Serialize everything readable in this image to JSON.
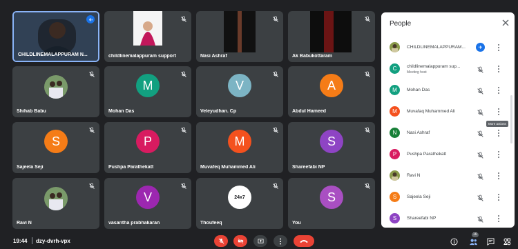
{
  "colors": {
    "accent": "#1a73e8",
    "danger": "#ea4335",
    "tile_bg": "#3c4043",
    "page_bg": "#202124"
  },
  "tiles": [
    {
      "name": "CHILDLINEMALAPPURAM N...",
      "type": "video",
      "speaking": true
    },
    {
      "name": "childlinemalappuram support",
      "type": "video",
      "muted": true
    },
    {
      "name": "Nasi Ashraf",
      "type": "video",
      "muted": true
    },
    {
      "name": "Ak Babukottaram",
      "type": "video",
      "muted": true
    },
    {
      "name": "Shihab Babu",
      "type": "photo",
      "muted": true
    },
    {
      "name": "Mohan Das",
      "initial": "M",
      "color": "#12a080",
      "muted": true
    },
    {
      "name": "Veleyudhan. Cp",
      "initial": "V",
      "color": "#7cb4c4",
      "muted": true
    },
    {
      "name": "Abdul Hameed",
      "initial": "A",
      "color": "#f57c17",
      "muted": true
    },
    {
      "name": "Sajeela Seji",
      "initial": "S",
      "color": "#f57c17",
      "muted": true
    },
    {
      "name": "Pushpa Parathekatt",
      "initial": "P",
      "color": "#d81b60",
      "muted": true
    },
    {
      "name": "Muvafeq Muhammed Ali",
      "initial": "M",
      "color": "#f4511e",
      "muted": true
    },
    {
      "name": "Shareefabi NP",
      "initial": "S",
      "color": "#8e44c4",
      "muted": true
    },
    {
      "name": "Ravi N",
      "type": "photo",
      "muted": true
    },
    {
      "name": "vasantha prabhakaran",
      "initial": "V",
      "color": "#9c27b0",
      "muted": true
    },
    {
      "name": "Thoufeeq",
      "type": "logo",
      "logo_text": "24x7",
      "muted": true
    },
    {
      "name": "You",
      "initial": "S",
      "color": "#a94fc2",
      "muted": true
    }
  ],
  "people_panel": {
    "title": "People",
    "tooltip": "More actions",
    "participants": [
      {
        "name": "CHILDLINEMALAPPURAM...",
        "sub": "",
        "avatar": "photo",
        "speaking": true
      },
      {
        "name": "childlinemalappuram sup...",
        "sub": "Meeting host",
        "initial": "C",
        "color": "#12a080"
      },
      {
        "name": "Mohan Das",
        "sub": "",
        "initial": "M",
        "color": "#12a080"
      },
      {
        "name": "Muvafaq Muhammed Ali",
        "sub": "",
        "initial": "M",
        "color": "#f4511e"
      },
      {
        "name": "Nasi Ashraf",
        "sub": "",
        "initial": "N",
        "color": "#188038"
      },
      {
        "name": "Pushpa Parathekatt",
        "sub": "",
        "initial": "P",
        "color": "#d81b60"
      },
      {
        "name": "Ravi N",
        "sub": "",
        "avatar": "photo"
      },
      {
        "name": "Sajeela Seji",
        "sub": "",
        "initial": "S",
        "color": "#f57c17"
      },
      {
        "name": "Shareefabi NP",
        "sub": "",
        "initial": "S",
        "color": "#8e44c4"
      }
    ]
  },
  "bottom_bar": {
    "time": "19:44",
    "meeting_code": "dzy-dvrh-vpx",
    "participant_count": "16"
  }
}
